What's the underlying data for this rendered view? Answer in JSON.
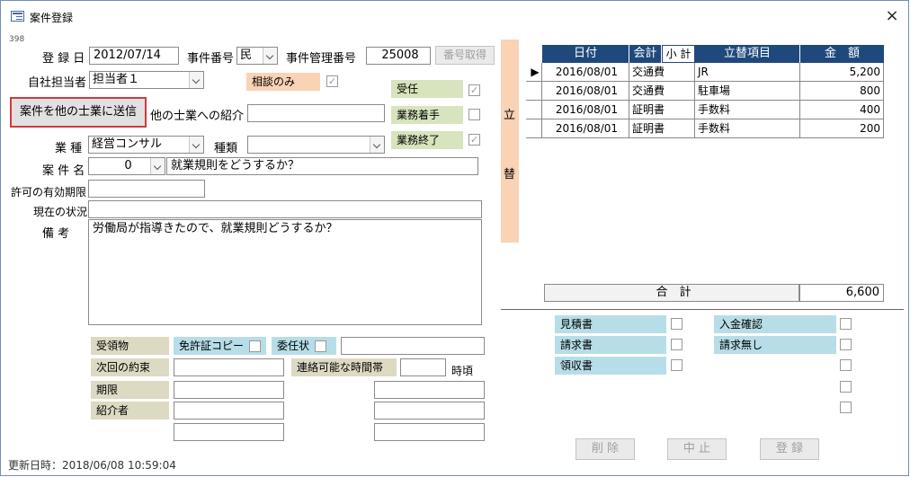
{
  "window": {
    "title": "案件登録",
    "close": "×"
  },
  "record_id": "398",
  "form": {
    "reg_date_label": "登 録 日",
    "reg_date": "2012/07/14",
    "case_no_label": "事件番号",
    "case_no_value": "民",
    "mgmt_no_label": "事件管理番号",
    "mgmt_no": "25008",
    "get_no_button": "番号取得",
    "owner_label": "自社担当者",
    "owner_value": "担当者１",
    "consult_label": "相談のみ",
    "consult_checked": "✓",
    "send_button": "案件を他の士業に送信",
    "referral_label": "他の士業への紹介",
    "referral_value": "",
    "jyunin_label": "受任",
    "jyunin_checked": "✓",
    "start_label": "業務着手",
    "end_label": "業務終了",
    "end_checked": "✓",
    "industry_label": "業 種",
    "industry_value": "経営コンサル",
    "kind_label": "種類",
    "kind_value": "",
    "casename_label": "案 件 名",
    "casename_num": "0",
    "casename_value": "就業規則をどうするか？",
    "permit_label": "許可の有効期限",
    "permit_value": "",
    "status_label": "現在の状況",
    "status_value": "",
    "remark_label": "備 考",
    "remark_value": "労働局が指導きたので、就業規則どうするか？",
    "received_label": "受領物",
    "license_label": "免許証コピー",
    "proxy_label": "委任状",
    "received_value": "",
    "next_label": "次回の約束",
    "contact_label": "連絡可能な時間帯",
    "contact_value": "",
    "contact_suffix": "時頃",
    "deadline_label": "期限",
    "introducer_label": "紹介者"
  },
  "advance": {
    "vertical_label": "立",
    "vertical_label2": "替",
    "headers": [
      "日付",
      "会計",
      "小 計",
      "立替項目",
      "金　額"
    ],
    "rows": [
      {
        "date": "2016/08/01",
        "kaikei": "交通費",
        "item": "JR",
        "amount": "5,200"
      },
      {
        "date": "2016/08/01",
        "kaikei": "交通費",
        "item": "駐車場",
        "amount": "800"
      },
      {
        "date": "2016/08/01",
        "kaikei": "証明書",
        "item": "手数料",
        "amount": "400"
      },
      {
        "date": "2016/08/01",
        "kaikei": "証明書",
        "item": "手数料",
        "amount": "200"
      }
    ],
    "total_label": "合　計",
    "total_value": "6,600"
  },
  "docs": {
    "estimate": "見積書",
    "invoice": "請求書",
    "receipt": "領収書",
    "payment": "入金確認",
    "no_invoice": "請求無し"
  },
  "buttons": {
    "delete": "削 除",
    "stop": "中 止",
    "register": "登 録"
  },
  "footer": {
    "updated": "更新日時：2018/06/08 10:59:04"
  }
}
